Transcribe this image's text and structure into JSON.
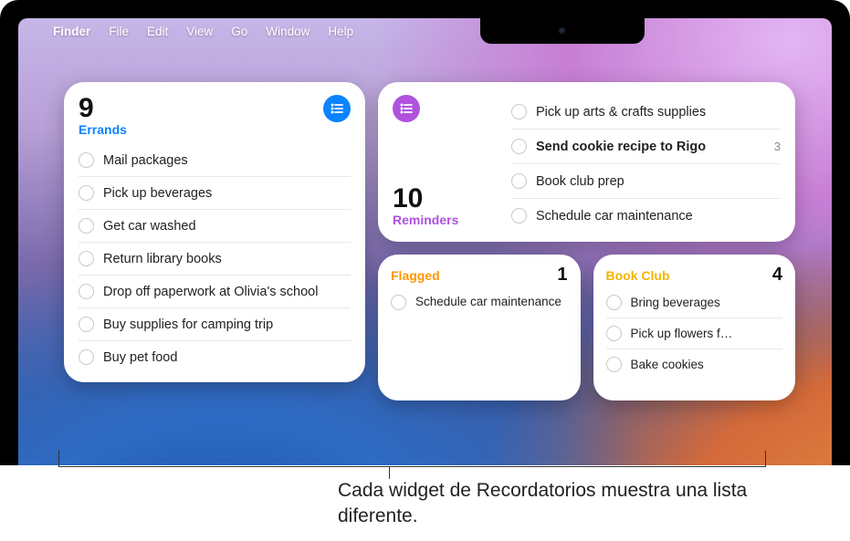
{
  "menubar": {
    "apple_glyph": "",
    "app": "Finder",
    "items": [
      "File",
      "Edit",
      "View",
      "Go",
      "Window",
      "Help"
    ]
  },
  "widgets": {
    "errands": {
      "count": "9",
      "name": "Errands",
      "color": "blue",
      "icon": "list-icon",
      "items": [
        "Mail packages",
        "Pick up beverages",
        "Get car washed",
        "Return library books",
        "Drop off paperwork at Olivia's school",
        "Buy supplies for camping trip",
        "Buy pet food"
      ]
    },
    "reminders": {
      "count": "10",
      "name": "Reminders",
      "color": "purple",
      "icon": "list-icon",
      "items": [
        {
          "text": "Pick up arts & crafts supplies",
          "bold": false,
          "count": ""
        },
        {
          "text": "Send cookie recipe to Rigo",
          "bold": true,
          "count": "3"
        },
        {
          "text": "Book club prep",
          "bold": false,
          "count": ""
        },
        {
          "text": "Schedule car maintenance",
          "bold": false,
          "count": ""
        }
      ]
    },
    "flagged": {
      "name": "Flagged",
      "count": "1",
      "color": "orange",
      "items": [
        "Schedule car maintenance"
      ]
    },
    "bookclub": {
      "name": "Book Club",
      "count": "4",
      "color": "yellow",
      "items": [
        "Bring beverages",
        "Pick up flowers f…",
        "Bake cookies"
      ]
    }
  },
  "caption": "Cada widget de Recordatorios muestra una lista diferente."
}
